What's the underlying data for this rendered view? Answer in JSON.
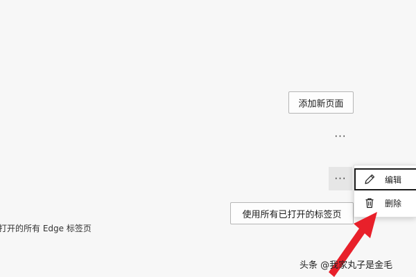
{
  "buttons": {
    "add_page": "添加新页面",
    "use_open_tabs": "使用所有已打开的标签页"
  },
  "more_menu": {
    "trigger_label": "···"
  },
  "description": "前打开的所有 Edge 标签页",
  "context_menu": {
    "items": [
      {
        "label": "编辑",
        "icon": "pencil-icon"
      },
      {
        "label": "删除",
        "icon": "trash-icon"
      }
    ]
  },
  "watermark": "头条 @我家丸子是金毛",
  "colors": {
    "arrow": "#e8202a",
    "background": "#f7f7f7"
  }
}
